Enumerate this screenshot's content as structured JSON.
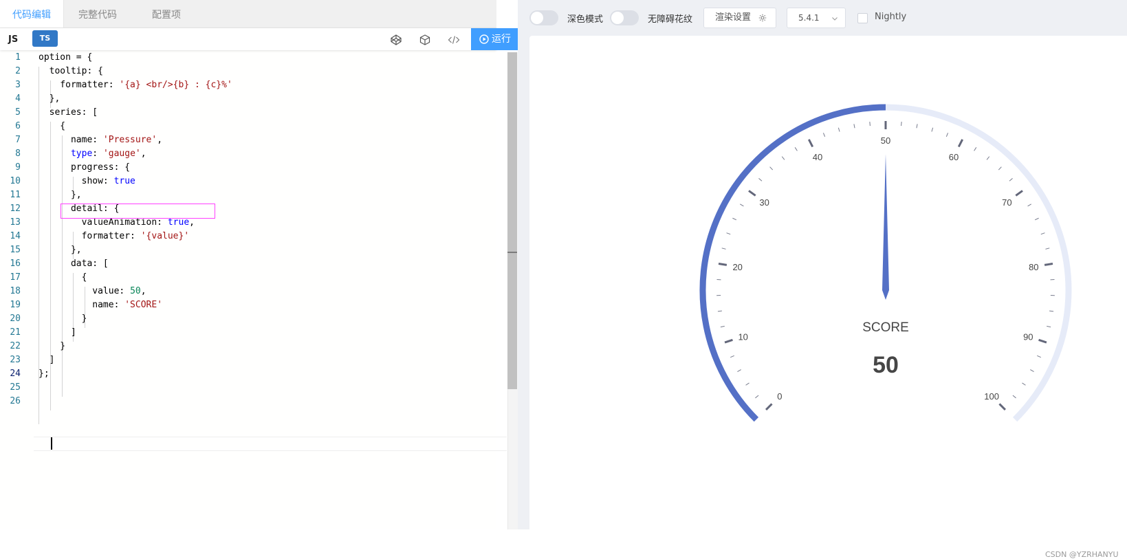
{
  "editor": {
    "tabs": [
      {
        "label": "代码编辑",
        "active": true
      },
      {
        "label": "完整代码",
        "active": false
      },
      {
        "label": "配置项",
        "active": false
      }
    ],
    "lang_js": "JS",
    "lang_ts": "TS",
    "tools": [
      "codepen-icon",
      "codesandbox-icon",
      "code-icon"
    ],
    "run_label": "运行",
    "accent_color": "#409eff",
    "current_line": 24,
    "code_lines": [
      "option = {",
      "  tooltip: {",
      "    formatter: '{a} <br/>{b} : {c}%'",
      "  },",
      "  series: [",
      "    {",
      "      name: 'Pressure',",
      "      type: 'gauge',",
      "      progress: {",
      "        show: true",
      "      },",
      "      detail: {",
      "        valueAnimation: true,",
      "        formatter: '{value}'",
      "      },",
      "      data: [",
      "        {",
      "          value: 50,",
      "          name: 'SCORE'",
      "        }",
      "      ]",
      "    }",
      "  ]",
      "};",
      "",
      ""
    ]
  },
  "preview": {
    "dark_mode_label": "深色模式",
    "dark_mode_on": false,
    "aria_label": "无障碍花纹",
    "aria_on": false,
    "render_settings_label": "渲染设置",
    "version": "5.4.1",
    "nightly_label": "Nightly",
    "nightly_checked": false,
    "watermark": "CSDN @YZRHANYU"
  },
  "chart_data": {
    "type": "gauge",
    "series_name": "Pressure",
    "min": 0,
    "max": 100,
    "value": 50,
    "data_name": "SCORE",
    "detail_text": "50",
    "major_ticks": [
      0,
      10,
      20,
      30,
      40,
      50,
      60,
      70,
      80,
      90,
      100
    ],
    "minor_splits": 5,
    "start_angle": 225,
    "end_angle": -45,
    "progress_color": "#5470c6",
    "track_color": "#e6ebf8",
    "tick_color": "#63677a"
  }
}
